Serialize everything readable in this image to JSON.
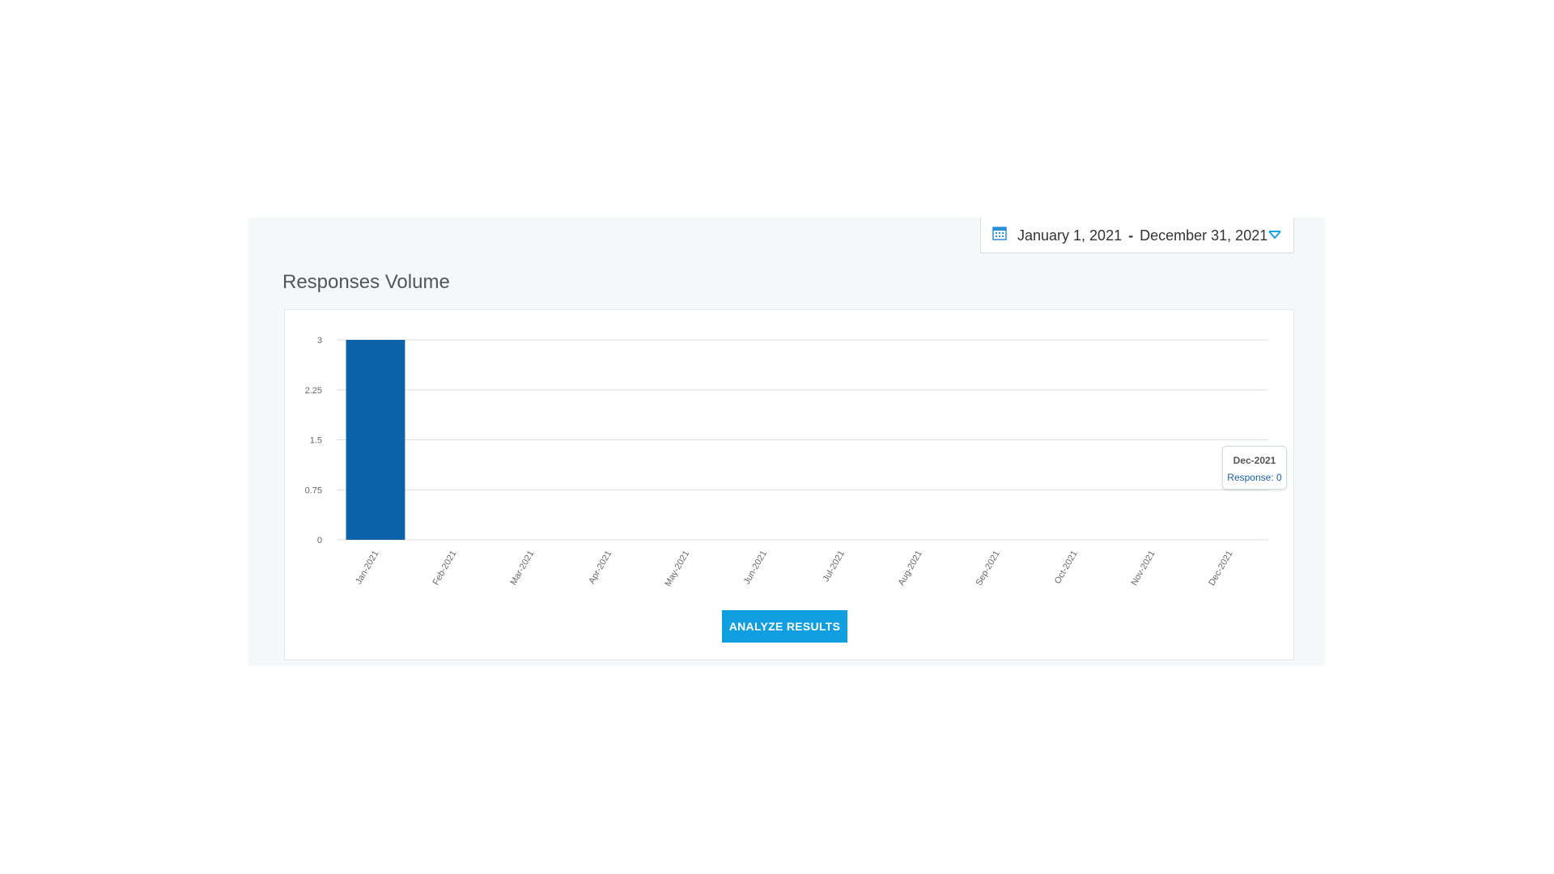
{
  "date_range": {
    "start": "January 1, 2021",
    "separator": "-",
    "end": "December 31, 2021"
  },
  "section": {
    "title": "Responses Volume"
  },
  "tooltip": {
    "title": "Dec-2021",
    "value": "Response: 0"
  },
  "actions": {
    "analyze_label": "ANALYZE RESULTS"
  },
  "colors": {
    "bar": "#0b62a8",
    "accent": "#0f9ee0",
    "grid": "#dddddd",
    "tick_text": "#666666"
  },
  "chart_data": {
    "type": "bar",
    "categories": [
      "Jan-2021",
      "Feb-2021",
      "Mar-2021",
      "Apr-2021",
      "May-2021",
      "Jun-2021",
      "Jul-2021",
      "Aug-2021",
      "Sep-2021",
      "Oct-2021",
      "Nov-2021",
      "Dec-2021"
    ],
    "values": [
      3,
      0,
      0,
      0,
      0,
      0,
      0,
      0,
      0,
      0,
      0,
      0
    ],
    "yticks": [
      "0",
      "0.75",
      "1.5",
      "2.25",
      "3"
    ],
    "ylim": [
      0,
      3
    ],
    "grid": true,
    "legend": "none"
  }
}
